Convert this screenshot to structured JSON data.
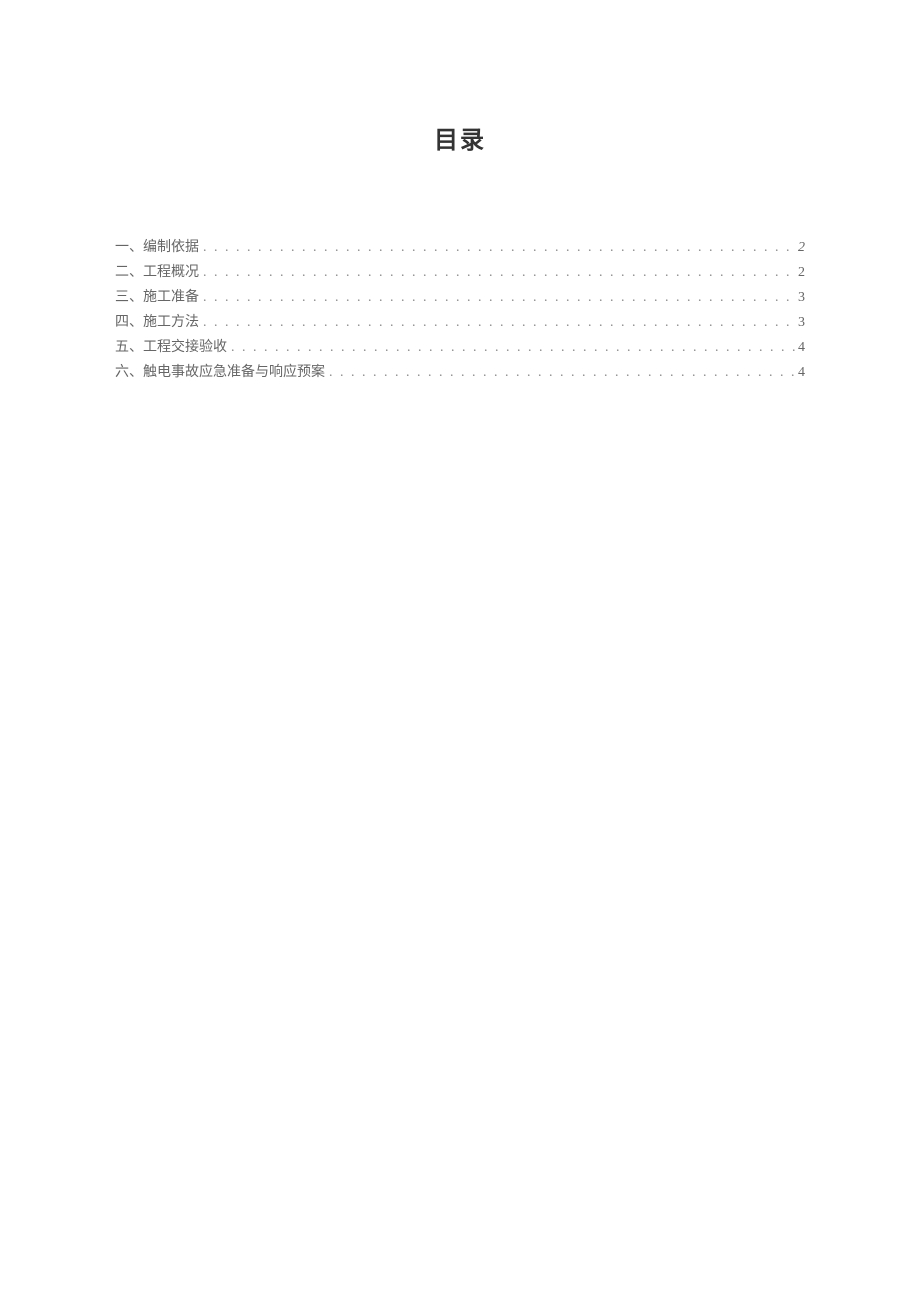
{
  "title": "目录",
  "toc": [
    {
      "label": "一、编制依据",
      "page": "2",
      "italic": true
    },
    {
      "label": "二、工程概况",
      "page": "2",
      "italic": false
    },
    {
      "label": "三、施工准备",
      "page": "3",
      "italic": false
    },
    {
      "label": "四、施工方法",
      "page": "3",
      "italic": false
    },
    {
      "label": "五、工程交接验收",
      "page": "4",
      "italic": false
    },
    {
      "label": "六、触电事故应急准备与响应预案",
      "page": "4",
      "italic": false
    }
  ]
}
